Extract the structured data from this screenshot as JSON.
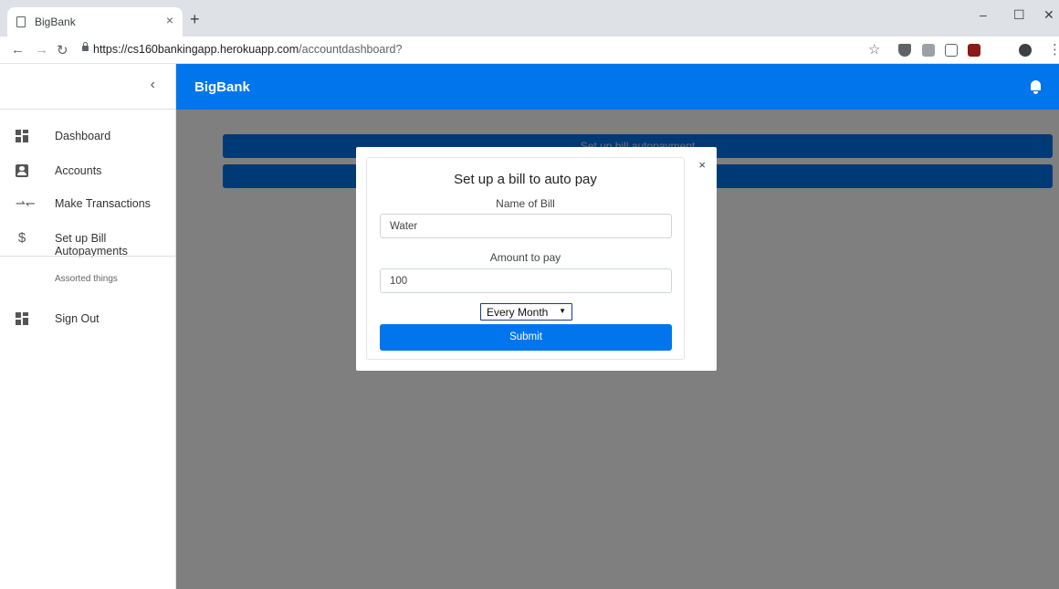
{
  "browser": {
    "tab_title": "BigBank",
    "tab_close": "×",
    "new_tab": "+",
    "url_host": "https://cs160bankingapp.herokuapp.com",
    "url_path": "/accountdashboard?",
    "window_controls": [
      "–",
      "☐",
      "✕"
    ]
  },
  "header": {
    "brand": "BigBank"
  },
  "sidebar": {
    "collapse_glyph": "‹",
    "items": [
      {
        "label": "Dashboard",
        "icon": "dashboard-icon"
      },
      {
        "label": "Accounts",
        "icon": "account-box-icon"
      },
      {
        "label": "Make Transactions",
        "icon": "swap-icon"
      },
      {
        "label": "Set up Bill Autopayments",
        "icon": "dollar-icon"
      }
    ],
    "section_title": "Assorted things",
    "sign_out": {
      "label": "Sign Out",
      "icon": "dashboard-icon"
    }
  },
  "main": {
    "bars": [
      "Set up bill autopayment",
      ""
    ]
  },
  "modal": {
    "close_glyph": "×",
    "title": "Set up a bill to auto pay",
    "name_label": "Name of Bill",
    "name_value": "Water",
    "amount_label": "Amount to pay",
    "amount_value": "100",
    "frequency_value": "Every Month",
    "submit_label": "Submit"
  },
  "colors": {
    "primary": "#0075ec",
    "overlay": "rgba(0,0,0,0.5)"
  }
}
